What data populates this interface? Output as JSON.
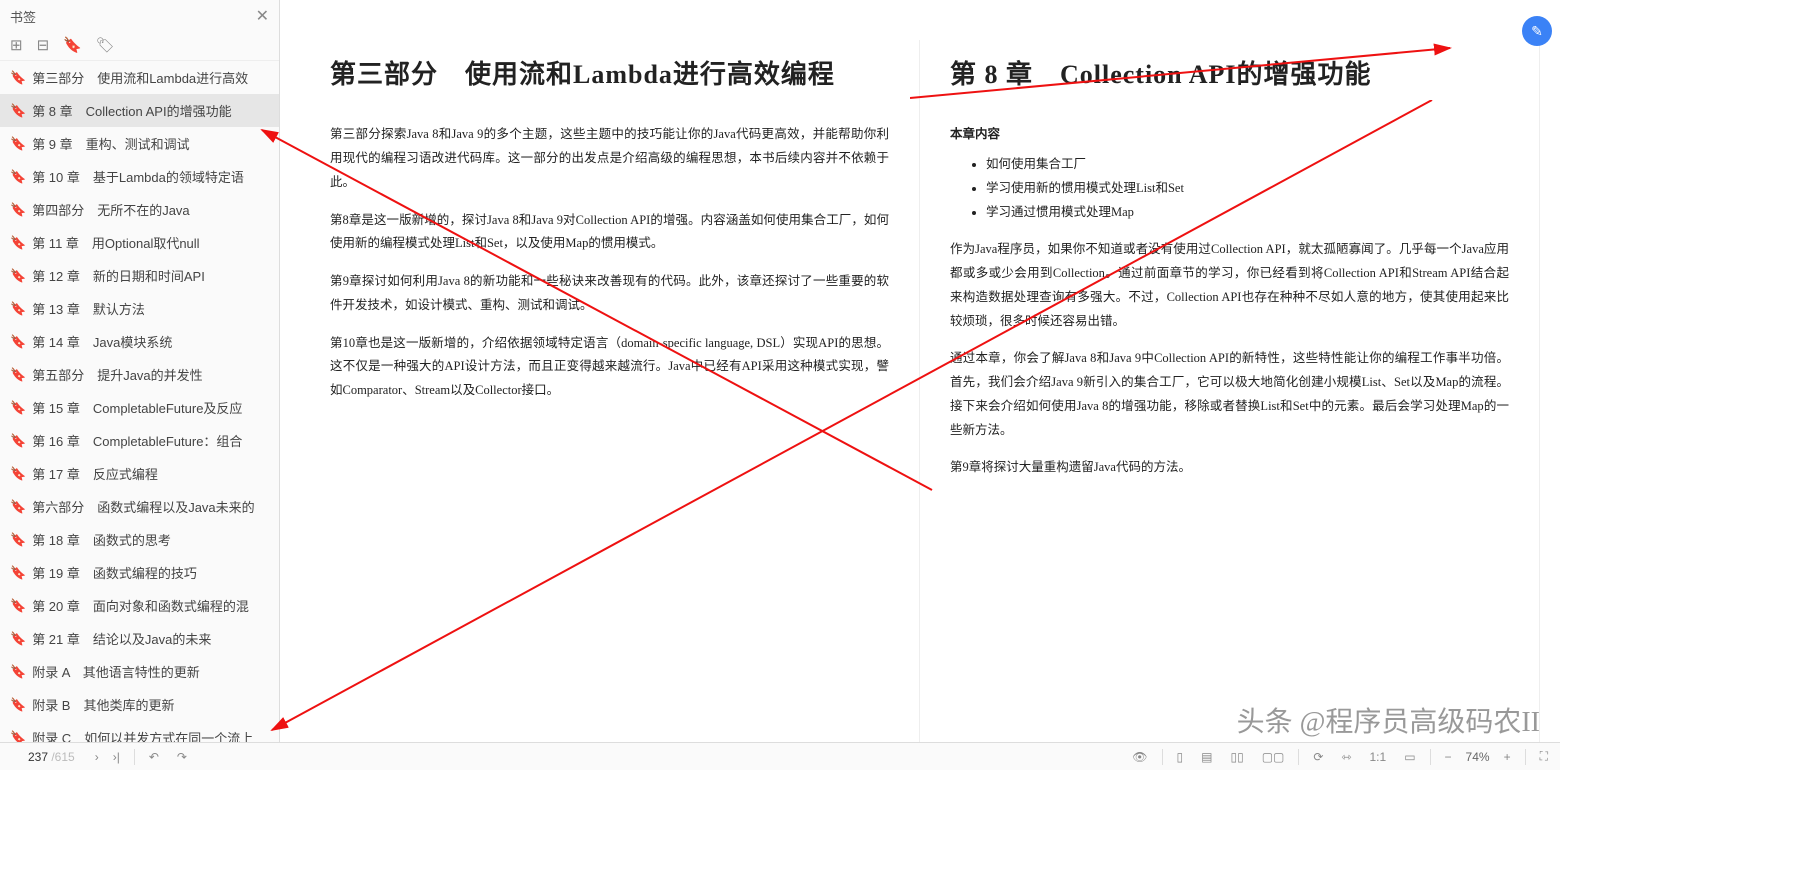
{
  "sidebar": {
    "title": "书签",
    "items": [
      {
        "label": "第三部分　使用流和Lambda进行高效",
        "sel": false
      },
      {
        "label": "第 8 章　Collection API的增强功能",
        "sel": true
      },
      {
        "label": "第 9 章　重构、测试和调试",
        "sel": false
      },
      {
        "label": "第 10 章　基于Lambda的领域特定语",
        "sel": false
      },
      {
        "label": "第四部分　无所不在的Java",
        "sel": false
      },
      {
        "label": "第 11 章　用Optional取代null",
        "sel": false
      },
      {
        "label": "第 12 章　新的日期和时间API",
        "sel": false
      },
      {
        "label": "第 13 章　默认方法",
        "sel": false
      },
      {
        "label": "第 14 章　Java模块系统",
        "sel": false
      },
      {
        "label": "第五部分　提升Java的并发性",
        "sel": false
      },
      {
        "label": "第 15 章　CompletableFuture及反应",
        "sel": false
      },
      {
        "label": "第 16 章　CompletableFuture：组合",
        "sel": false
      },
      {
        "label": "第 17 章　反应式编程",
        "sel": false
      },
      {
        "label": "第六部分　函数式编程以及Java未来的",
        "sel": false
      },
      {
        "label": "第 18 章　函数式的思考",
        "sel": false
      },
      {
        "label": "第 19 章　函数式编程的技巧",
        "sel": false
      },
      {
        "label": "第 20 章　面向对象和函数式编程的混",
        "sel": false
      },
      {
        "label": "第 21 章　结论以及Java的未来",
        "sel": false
      },
      {
        "label": "附录 A　其他语言特性的更新",
        "sel": false
      },
      {
        "label": "附录 B　其他类库的更新",
        "sel": false
      },
      {
        "label": "附录 C　如何以并发方式在同一个流上",
        "sel": false
      }
    ]
  },
  "left_page": {
    "title": "第三部分　使用流和Lambda进行高效编程",
    "p1": "第三部分探索Java 8和Java 9的多个主题，这些主题中的技巧能让你的Java代码更高效，并能帮助你利用现代的编程习语改进代码库。这一部分的出发点是介绍高级的编程思想，本书后续内容并不依赖于此。",
    "p2": "第8章是这一版新增的，探讨Java 8和Java 9对Collection API的增强。内容涵盖如何使用集合工厂，如何使用新的编程模式处理List和Set，以及使用Map的惯用模式。",
    "p3": "第9章探讨如何利用Java 8的新功能和一些秘诀来改善现有的代码。此外，该章还探讨了一些重要的软件开发技术，如设计模式、重构、测试和调试。",
    "p4": "第10章也是这一版新增的，介绍依据领域特定语言（domain-specific language, DSL）实现API的思想。这不仅是一种强大的API设计方法，而且正变得越来越流行。Java中已经有API采用这种模式实现，譬如Comparator、Stream以及Collector接口。"
  },
  "right_page": {
    "title": "第 8 章　Collection API的增强功能",
    "sub": "本章内容",
    "li1": "如何使用集合工厂",
    "li2": "学习使用新的惯用模式处理List和Set",
    "li3": "学习通过惯用模式处理Map",
    "p1": "作为Java程序员，如果你不知道或者没有使用过Collection API，就太孤陋寡闻了。几乎每一个Java应用都或多或少会用到Collection。通过前面章节的学习，你已经看到将Collection API和Stream API结合起来构造数据处理查询有多强大。不过，Collection API也存在种种不尽如人意的地方，使其使用起来比较烦琐，很多时候还容易出错。",
    "p2": "通过本章，你会了解Java 8和Java 9中Collection API的新特性，这些特性能让你的编程工作事半功倍。首先，我们会介绍Java 9新引入的集合工厂，它可以极大地简化创建小规模List、Set以及Map的流程。接下来会介绍如何使用Java 8的增强功能，移除或者替换List和Set中的元素。最后会学习处理Map的一些新方法。",
    "p3": "第9章将探讨大量重构遗留Java代码的方法。"
  },
  "status": {
    "current": "237",
    "total": "/615",
    "zoom": "74%"
  },
  "watermark": "头条 @程序员高级码农II"
}
